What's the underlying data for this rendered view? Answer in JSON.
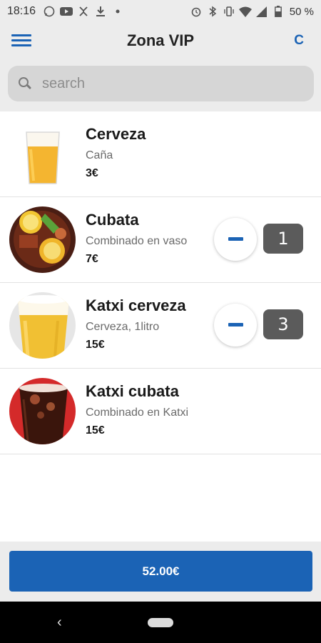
{
  "status_bar": {
    "time": "18:16",
    "battery": "50 %"
  },
  "header": {
    "title": "Zona VIP",
    "clear_label": "C"
  },
  "search": {
    "placeholder": "search"
  },
  "items": [
    {
      "name": "Cerveza",
      "description": "Caña",
      "price": "3€",
      "quantity": null
    },
    {
      "name": "Cubata",
      "description": "Combinado en vaso",
      "price": "7€",
      "quantity": "1"
    },
    {
      "name": "Katxi cerveza",
      "description": "Cerveza, 1litro",
      "price": "15€",
      "quantity": "3"
    },
    {
      "name": "Katxi cubata",
      "description": "Combinado en Katxi",
      "price": "15€",
      "quantity": null
    }
  ],
  "footer": {
    "total": "52.00€"
  },
  "colors": {
    "accent": "#1b63b5",
    "badge": "#5b5b5b",
    "background": "#ececec"
  }
}
